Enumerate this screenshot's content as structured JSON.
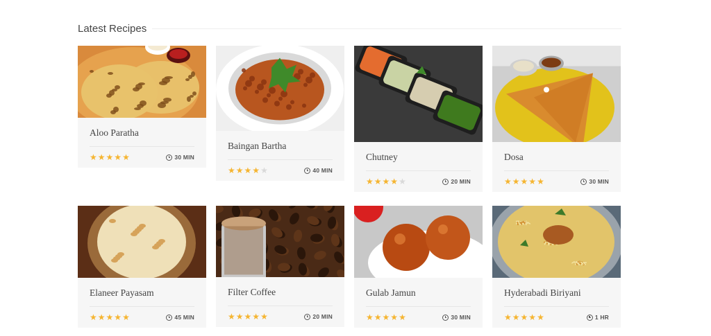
{
  "section": {
    "title": "Latest Recipes"
  },
  "recipes": [
    {
      "name": "Aloo Paratha",
      "rating": 5,
      "time": "30 MIN",
      "icon": "clock-icon",
      "dish": "paratha",
      "colors": {
        "bg": "#d98a3c",
        "plate": "#e6a24e",
        "food": "#e8c26b",
        "accent": "#7a4a18"
      }
    },
    {
      "name": "Baingan Bartha",
      "rating": 4,
      "time": "40 MIN",
      "icon": "clock-icon",
      "dish": "bowl",
      "colors": {
        "bg": "#efefef",
        "plate": "#ffffff",
        "food": "#b8561f",
        "accent": "#3f8a2a"
      }
    },
    {
      "name": "Chutney",
      "rating": 4,
      "time": "20 MIN",
      "icon": "clock-icon",
      "dish": "trays",
      "colors": {
        "bg": "#3a3a3a",
        "plate": "#1e1e1e",
        "food": "#d6cdb0",
        "accent": "#e46c2f"
      }
    },
    {
      "name": "Dosa",
      "rating": 5,
      "time": "30 MIN",
      "icon": "clock-icon",
      "dish": "dosa",
      "colors": {
        "bg": "#cfcfcf",
        "plate": "#e2c21b",
        "food": "#d98b2e",
        "accent": "#7c3b12"
      }
    },
    {
      "name": "Elaneer Payasam",
      "rating": 5,
      "time": "45 MIN",
      "icon": "clock-icon",
      "dish": "payasam",
      "colors": {
        "bg": "#5b2e16",
        "plate": "#9a6a3a",
        "food": "#efe0b8",
        "accent": "#d6a35a"
      }
    },
    {
      "name": "Filter Coffee",
      "rating": 5,
      "time": "20 MIN",
      "icon": "clock-icon",
      "dish": "coffee",
      "colors": {
        "bg": "#4a2a16",
        "plate": "#c9c9c9",
        "food": "#c9a27a",
        "accent": "#2a160a"
      }
    },
    {
      "name": "Gulab Jamun",
      "rating": 5,
      "time": "30 MIN",
      "icon": "clock-icon",
      "dish": "jamun",
      "colors": {
        "bg": "#c8c8c8",
        "plate": "#ffffff",
        "food": "#b84a12",
        "accent": "#d92020"
      }
    },
    {
      "name": "Hyderabadi Biriyani",
      "rating": 5,
      "time": "1 HR",
      "icon": "clock-icon",
      "dish": "biriyani",
      "colors": {
        "bg": "#5a6a78",
        "plate": "#9aa3ab",
        "food": "#e2c46a",
        "accent": "#3d7a2a"
      }
    }
  ]
}
